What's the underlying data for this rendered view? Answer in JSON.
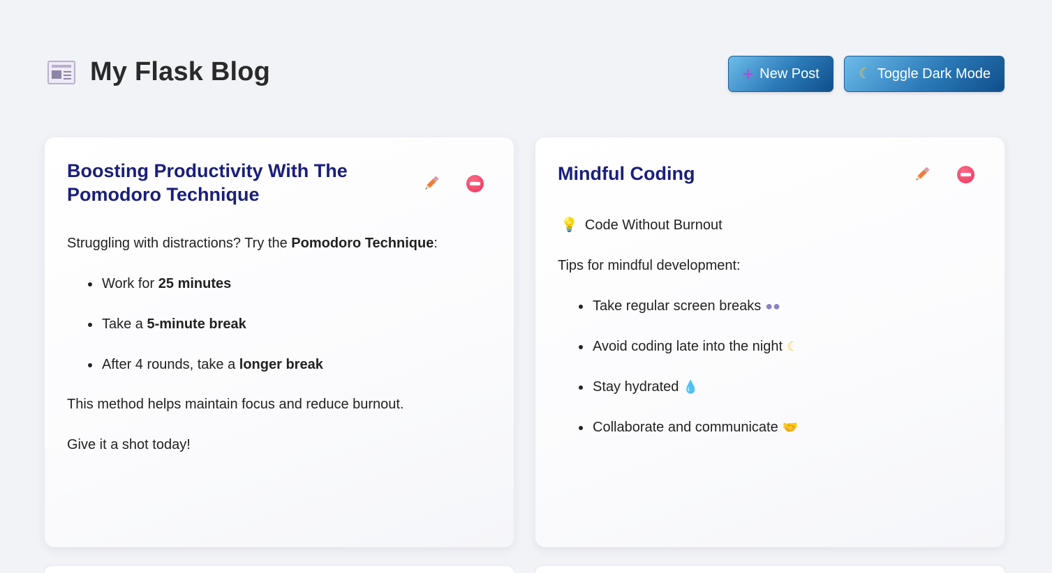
{
  "header": {
    "title": "My Flask Blog",
    "title_icon": "newspaper-icon",
    "new_post_label": "New Post",
    "new_post_icon": "plus-icon",
    "toggle_dark_label": "Toggle Dark Mode",
    "toggle_dark_icon": "crescent-moon-icon"
  },
  "posts": [
    {
      "title": "Boosting Productivity With The Pomodoro Technique",
      "edit_icon": "pencil-icon",
      "delete_icon": "no-entry-icon",
      "intro_pre": "Struggling with distractions? Try the ",
      "intro_bold": "Pomodoro Technique",
      "intro_post": ":",
      "items": [
        {
          "pre": "Work for ",
          "bold": "25 minutes"
        },
        {
          "pre": "Take a ",
          "bold": "5-minute break"
        },
        {
          "pre": "After 4 rounds, take a ",
          "bold": "longer break"
        }
      ],
      "para1": "This method helps maintain focus and reduce burnout.",
      "para2": "Give it a shot today!"
    },
    {
      "title": "Mindful Coding",
      "edit_icon": "pencil-icon",
      "delete_icon": "no-entry-icon",
      "lead_icon": "light-bulb-icon",
      "lead_text": "Code Without Burnout",
      "intro": "Tips for mindful development:",
      "items": [
        {
          "text": "Take regular screen breaks",
          "emoji": "eyes-icon"
        },
        {
          "text": "Avoid coding late into the night",
          "emoji": "crescent-moon-icon"
        },
        {
          "text": "Stay hydrated",
          "emoji": "droplet-icon"
        },
        {
          "text": "Collaborate and communicate",
          "emoji": "handshake-icon"
        }
      ]
    }
  ],
  "colors": {
    "page_bg": "#f2f3f7",
    "title_color": "#1a1f7a",
    "button_gradient_start": "#6dbcea",
    "button_gradient_end": "#0f4f8a",
    "delete_red": "#e8335a",
    "pencil_orange": "#f07a3a"
  }
}
